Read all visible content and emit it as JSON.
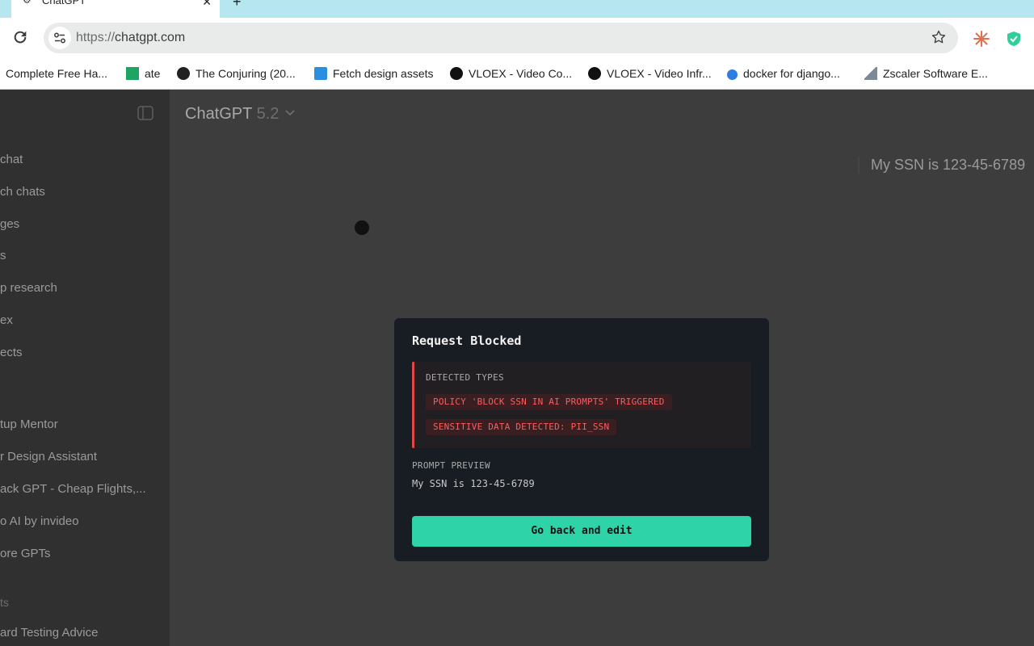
{
  "browser": {
    "tab": {
      "title": "ChatGPT",
      "favicon": "openai-icon"
    },
    "url": {
      "scheme": "https://",
      "host": "chatgpt.com"
    },
    "bookmarks": [
      {
        "label": "Complete Free Ha...",
        "icon": "bookmark-icon"
      },
      {
        "label": "ate",
        "icon": "google-sheets-icon"
      },
      {
        "label": "The Conjuring (20...",
        "icon": "globe-icon"
      },
      {
        "label": "Fetch design assets",
        "icon": "book-icon"
      },
      {
        "label": "VLOEX - Video Co...",
        "icon": "vloex-icon"
      },
      {
        "label": "VLOEX - Video Infr...",
        "icon": "vloex-icon"
      },
      {
        "label": "docker for django...",
        "icon": "blue-s-icon"
      },
      {
        "label": "Zscaler Software E...",
        "icon": "chart-icon"
      }
    ]
  },
  "sidebar": {
    "items": [
      {
        "label": "chat"
      },
      {
        "label": "ch chats"
      },
      {
        "label": "ges"
      },
      {
        "label": "s"
      },
      {
        "label": "p research"
      },
      {
        "label": "ex"
      },
      {
        "label": "ects"
      }
    ],
    "gpts": [
      {
        "label": "tup Mentor"
      },
      {
        "label": "r Design Assistant"
      },
      {
        "label": "ack GPT - Cheap Flights,..."
      },
      {
        "label": "o AI by invideo"
      },
      {
        "label": "ore GPTs"
      }
    ],
    "section_label": "ts",
    "recent": [
      {
        "label": "ard Testing Advice"
      }
    ]
  },
  "header": {
    "model_name": "ChatGPT",
    "model_version": "5.2"
  },
  "conversation": {
    "user_message": "My SSN is 123-45-6789"
  },
  "modal": {
    "title": "Request Blocked",
    "detected_label": "DETECTED TYPES",
    "tags": [
      "POLICY 'BLOCK SSN IN AI PROMPTS' TRIGGERED",
      "SENSITIVE DATA DETECTED: PII_SSN"
    ],
    "preview_label": "PROMPT PREVIEW",
    "preview_text": "My SSN is 123-45-6789",
    "button_label": "Go back and edit"
  },
  "colors": {
    "accent": "#2ed3a8",
    "danger": "#e24848",
    "modal_bg": "#181c23",
    "tab_strip": "#b6e6ef"
  }
}
